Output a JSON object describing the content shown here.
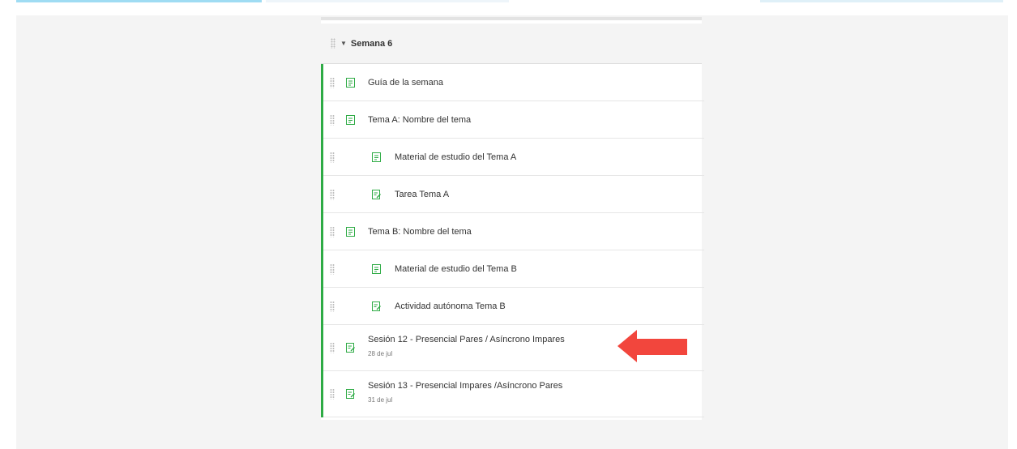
{
  "module": {
    "title": "Semana 6",
    "items": [
      {
        "label": "Guía de la semana",
        "icon": "page-icon",
        "level": 0
      },
      {
        "label": "Tema A: Nombre del tema",
        "icon": "page-icon",
        "level": 0
      },
      {
        "label": "Material de estudio del Tema A",
        "icon": "page-icon",
        "level": 1
      },
      {
        "label": "Tarea Tema A",
        "icon": "assignment-icon",
        "level": 1
      },
      {
        "label": "Tema B: Nombre del tema",
        "icon": "page-icon",
        "level": 0
      },
      {
        "label": "Material de estudio del Tema B",
        "icon": "page-icon",
        "level": 1
      },
      {
        "label": "Actividad autónoma Tema B",
        "icon": "assignment-icon",
        "level": 1
      },
      {
        "label": "Sesión 12 - Presencial Pares / Asíncrono Impares",
        "date": "28 de jul",
        "icon": "assignment-icon",
        "level": 0
      },
      {
        "label": "Sesión 13 - Presencial Impares /Asíncrono Pares",
        "date": "31 de jul",
        "icon": "assignment-icon",
        "level": 0
      }
    ]
  },
  "colors": {
    "accent_green": "#2eab45",
    "arrow_red": "#f2463d"
  }
}
